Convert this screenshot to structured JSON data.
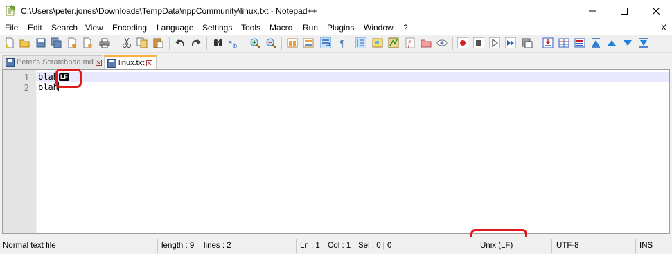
{
  "window": {
    "title": "C:\\Users\\peter.jones\\Downloads\\TempData\\nppCommunity\\linux.txt - Notepad++"
  },
  "menu": {
    "items": [
      "File",
      "Edit",
      "Search",
      "View",
      "Encoding",
      "Language",
      "Settings",
      "Tools",
      "Macro",
      "Run",
      "Plugins",
      "Window",
      "?"
    ],
    "close_glyph": "X"
  },
  "tabs": [
    {
      "label": "Peter's Scratchpad.md",
      "active": false
    },
    {
      "label": "linux.txt",
      "active": true
    }
  ],
  "editor": {
    "line_numbers": [
      "1",
      "2"
    ],
    "lines": [
      "blah",
      "blah"
    ],
    "eol_marker": "LF"
  },
  "statusbar": {
    "file_type": "Normal text file",
    "length": "length : 9",
    "lines": "lines : 2",
    "ln": "Ln : 1",
    "col": "Col : 1",
    "sel": "Sel : 0 | 0",
    "eol": "Unix (LF)",
    "encoding": "UTF-8",
    "mode": "INS"
  },
  "colors": {
    "annotation": "#e01a1a",
    "active_tab_accent": "#fab041",
    "current_line": "#e8e8ff",
    "gutter": "#e4e4e4"
  },
  "icons": {
    "toolbar": [
      "new-file-icon",
      "open-file-icon",
      "save-icon",
      "save-all-icon",
      "close-icon",
      "close-all-icon",
      "print-icon",
      "cut-icon",
      "copy-icon",
      "paste-icon",
      "undo-icon",
      "redo-icon",
      "find-icon",
      "replace-icon",
      "zoom-in-icon",
      "zoom-out-icon",
      "sync-vertical-icon",
      "sync-horizontal-icon",
      "word-wrap-icon",
      "show-all-chars-icon",
      "indent-guide-icon",
      "udl-icon",
      "doc-map-icon",
      "function-list-icon",
      "folder-workspace-icon",
      "monitoring-icon",
      "record-macro-icon",
      "stop-record-icon",
      "play-macro-icon",
      "run-macro-multiple-icon",
      "save-macro-icon",
      "insert-line-icon",
      "view-grid-icon",
      "column-edit-icon",
      "collapse-all-icon",
      "move-up-icon",
      "move-down-icon",
      "expand-all-icon"
    ]
  }
}
